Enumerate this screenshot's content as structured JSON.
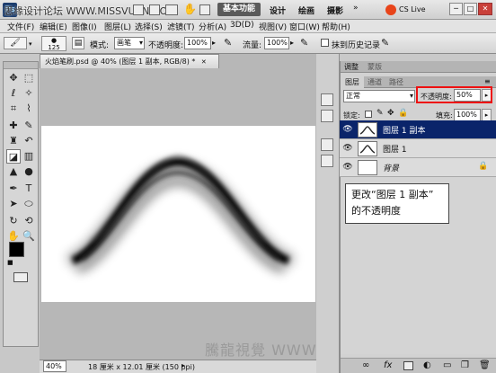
{
  "watermark_top": "思缘设计论坛 WWW.MISSVUAN.COM",
  "watermark_bottom": "騰龍視覺 WWW.TLVI.NET",
  "titlebar": {
    "workspace_button": "基本功能",
    "workspace_tabs": [
      "设计",
      "绘画",
      "摄影"
    ],
    "more": "»",
    "cslive": "CS Live",
    "window_controls": [
      "─",
      "□",
      "✕"
    ]
  },
  "menu": [
    "文件(F)",
    "编辑(E)",
    "图像(I)",
    "图层(L)",
    "选择(S)",
    "滤镜(T)",
    "分析(A)",
    "3D(D)",
    "视图(V)",
    "窗口(W)",
    "帮助(H)"
  ],
  "options": {
    "brush_size": "125",
    "mode_label": "模式:",
    "mode_value": "画笔",
    "opacity_label": "不透明度:",
    "opacity_value": "100%",
    "flow_label": "流量:",
    "flow_value": "100%",
    "erase_history_label": "抹到历史记录"
  },
  "document": {
    "tab_title": "火焰笔刷.psd @ 40% (图层 1 副本, RGB/8) *",
    "tab_close": "✕",
    "zoom": "40%",
    "doc_size": "18 厘米 x 12.01 厘米 (150 ppi)"
  },
  "panels": {
    "top_tabs": [
      "调整",
      "蒙版"
    ],
    "layer_tabs": [
      "图层",
      "通道",
      "路径"
    ],
    "blend_mode": "正常",
    "opacity_label": "不透明度:",
    "opacity_value": "50%",
    "lock_label": "锁定:",
    "fill_label": "填充:",
    "fill_value": "100%",
    "layers": [
      {
        "name": "图层 1 副本",
        "selected": true
      },
      {
        "name": "图层 1",
        "selected": false
      },
      {
        "name": "背景",
        "selected": false
      }
    ]
  },
  "callout": {
    "line1": "更改“图层 1 副本”",
    "line2": "的不透明度"
  },
  "colors": {
    "selection": "#0a246a",
    "highlight_box": "#e11111",
    "workspace_button": "#5a5a5a",
    "cslive_icon": "#e8441a"
  }
}
